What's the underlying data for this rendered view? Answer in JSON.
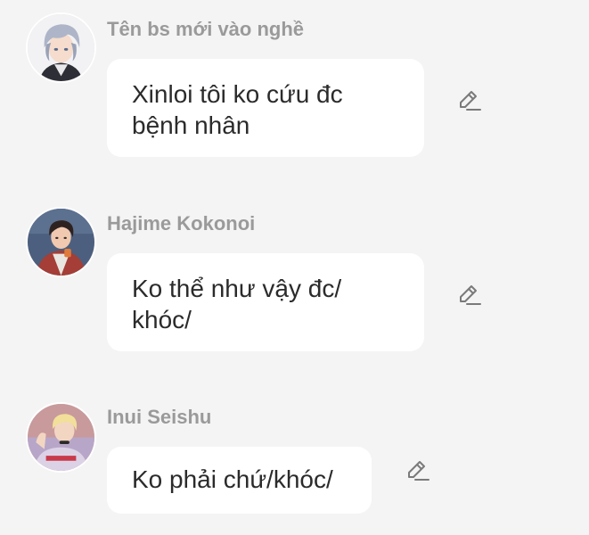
{
  "messages": [
    {
      "sender": "Tên bs mới vào nghề",
      "avatar_icon": "avatar-silver-hair-character",
      "text": "Xinloi tôi ko cứu đc bệnh nhân",
      "edit_icon": "pencil-icon"
    },
    {
      "sender": "Hajime Kokonoi",
      "avatar_icon": "avatar-dark-hair-red-jacket",
      "text": "Ko thể như vậy đc/ khóc/",
      "edit_icon": "pencil-icon"
    },
    {
      "sender": "Inui Seishu",
      "avatar_icon": "avatar-blonde-hair-character",
      "text": "Ko phải chứ/khóc/",
      "edit_icon": "pencil-icon"
    }
  ],
  "colors": {
    "background": "#f4f4f4",
    "bubble": "#ffffff",
    "sender_text": "#9a9a9a",
    "message_text": "#2b2b2b",
    "icon": "#7a7a7a"
  }
}
